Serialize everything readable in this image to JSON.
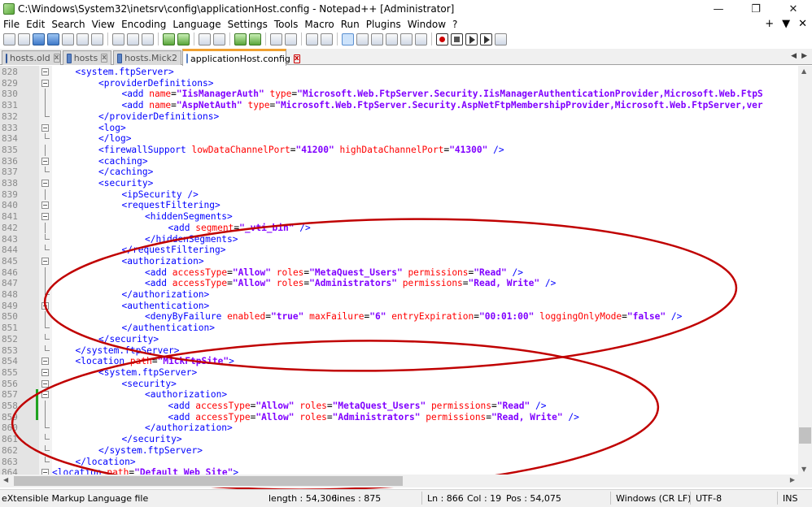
{
  "window": {
    "title": "C:\\Windows\\System32\\inetsrv\\config\\applicationHost.config - Notepad++ [Administrator]",
    "minimize": "—",
    "maximize": "❐",
    "close": "✕"
  },
  "menu": {
    "items": [
      "File",
      "Edit",
      "Search",
      "View",
      "Encoding",
      "Language",
      "Settings",
      "Tools",
      "Macro",
      "Run",
      "Plugins",
      "Window",
      "?"
    ],
    "right": [
      "+",
      "▼",
      "✕"
    ]
  },
  "tabs": [
    {
      "label": "hosts.old",
      "active": false
    },
    {
      "label": "hosts",
      "active": false
    },
    {
      "label": "hosts.Mick2",
      "active": false
    },
    {
      "label": "applicationHost.config",
      "active": true
    }
  ],
  "tab_scroll": [
    "◀",
    "▶"
  ],
  "editor": {
    "lines": [
      {
        "n": "828",
        "indent": 1,
        "parts": [
          [
            "br",
            "<"
          ],
          [
            "tag",
            "system.ftpServer"
          ],
          [
            "br",
            ">"
          ]
        ]
      },
      {
        "n": "829",
        "indent": 2,
        "parts": [
          [
            "br",
            "<"
          ],
          [
            "tag",
            "providerDefinitions"
          ],
          [
            "br",
            ">"
          ]
        ]
      },
      {
        "n": "830",
        "indent": 3,
        "parts": [
          [
            "br",
            "<"
          ],
          [
            "tag",
            "add"
          ],
          [
            "sp",
            " "
          ],
          [
            "attr",
            "name"
          ],
          [
            "eq",
            "="
          ],
          [
            "val",
            "\"IisManagerAuth\""
          ],
          [
            "sp",
            " "
          ],
          [
            "attr",
            "type"
          ],
          [
            "eq",
            "="
          ],
          [
            "val",
            "\"Microsoft.Web.FtpServer.Security.IisManagerAuthenticationProvider,Microsoft.Web.FtpS"
          ]
        ]
      },
      {
        "n": "831",
        "indent": 3,
        "parts": [
          [
            "br",
            "<"
          ],
          [
            "tag",
            "add"
          ],
          [
            "sp",
            " "
          ],
          [
            "attr",
            "name"
          ],
          [
            "eq",
            "="
          ],
          [
            "val",
            "\"AspNetAuth\""
          ],
          [
            "sp",
            " "
          ],
          [
            "attr",
            "type"
          ],
          [
            "eq",
            "="
          ],
          [
            "val",
            "\"Microsoft.Web.FtpServer.Security.AspNetFtpMembershipProvider,Microsoft.Web.FtpServer,ver"
          ]
        ]
      },
      {
        "n": "832",
        "indent": 2,
        "parts": [
          [
            "br",
            "</"
          ],
          [
            "tag",
            "providerDefinitions"
          ],
          [
            "br",
            ">"
          ]
        ]
      },
      {
        "n": "833",
        "indent": 2,
        "parts": [
          [
            "br",
            "<"
          ],
          [
            "tag",
            "log"
          ],
          [
            "br",
            ">"
          ]
        ]
      },
      {
        "n": "834",
        "indent": 2,
        "parts": [
          [
            "br",
            "</"
          ],
          [
            "tag",
            "log"
          ],
          [
            "br",
            ">"
          ]
        ]
      },
      {
        "n": "835",
        "indent": 2,
        "parts": [
          [
            "br",
            "<"
          ],
          [
            "tag",
            "firewallSupport"
          ],
          [
            "sp",
            " "
          ],
          [
            "attr",
            "lowDataChannelPort"
          ],
          [
            "eq",
            "="
          ],
          [
            "val",
            "\"41200\""
          ],
          [
            "sp",
            " "
          ],
          [
            "attr",
            "highDataChannelPort"
          ],
          [
            "eq",
            "="
          ],
          [
            "val",
            "\"41300\""
          ],
          [
            "sp",
            " "
          ],
          [
            "br",
            "/>"
          ]
        ]
      },
      {
        "n": "836",
        "indent": 2,
        "parts": [
          [
            "br",
            "<"
          ],
          [
            "tag",
            "caching"
          ],
          [
            "br",
            ">"
          ]
        ]
      },
      {
        "n": "837",
        "indent": 2,
        "parts": [
          [
            "br",
            "</"
          ],
          [
            "tag",
            "caching"
          ],
          [
            "br",
            ">"
          ]
        ]
      },
      {
        "n": "838",
        "indent": 2,
        "parts": [
          [
            "br",
            "<"
          ],
          [
            "tag",
            "security"
          ],
          [
            "br",
            ">"
          ]
        ]
      },
      {
        "n": "839",
        "indent": 3,
        "parts": [
          [
            "br",
            "<"
          ],
          [
            "tag",
            "ipSecurity"
          ],
          [
            "sp",
            " "
          ],
          [
            "br",
            "/>"
          ]
        ]
      },
      {
        "n": "840",
        "indent": 3,
        "parts": [
          [
            "br",
            "<"
          ],
          [
            "tag",
            "requestFiltering"
          ],
          [
            "br",
            ">"
          ]
        ]
      },
      {
        "n": "841",
        "indent": 4,
        "parts": [
          [
            "br",
            "<"
          ],
          [
            "tag",
            "hiddenSegments"
          ],
          [
            "br",
            ">"
          ]
        ]
      },
      {
        "n": "842",
        "indent": 5,
        "parts": [
          [
            "br",
            "<"
          ],
          [
            "tag",
            "add"
          ],
          [
            "sp",
            " "
          ],
          [
            "attr",
            "segment"
          ],
          [
            "eq",
            "="
          ],
          [
            "val",
            "\"_vti_bin\""
          ],
          [
            "sp",
            " "
          ],
          [
            "br",
            "/>"
          ]
        ]
      },
      {
        "n": "843",
        "indent": 4,
        "parts": [
          [
            "br",
            "</"
          ],
          [
            "tag",
            "hiddenSegments"
          ],
          [
            "br",
            ">"
          ]
        ]
      },
      {
        "n": "844",
        "indent": 3,
        "parts": [
          [
            "br",
            "</"
          ],
          [
            "tag",
            "requestFiltering"
          ],
          [
            "br",
            ">"
          ]
        ]
      },
      {
        "n": "845",
        "indent": 3,
        "parts": [
          [
            "br",
            "<"
          ],
          [
            "tag",
            "authorization"
          ],
          [
            "br",
            ">"
          ]
        ]
      },
      {
        "n": "846",
        "indent": 4,
        "parts": [
          [
            "br",
            "<"
          ],
          [
            "tag",
            "add"
          ],
          [
            "sp",
            " "
          ],
          [
            "attr",
            "accessType"
          ],
          [
            "eq",
            "="
          ],
          [
            "val",
            "\"Allow\""
          ],
          [
            "sp",
            " "
          ],
          [
            "attr",
            "roles"
          ],
          [
            "eq",
            "="
          ],
          [
            "val",
            "\"MetaQuest_Users\""
          ],
          [
            "sp",
            " "
          ],
          [
            "attr",
            "permissions"
          ],
          [
            "eq",
            "="
          ],
          [
            "val",
            "\"Read\""
          ],
          [
            "sp",
            " "
          ],
          [
            "br",
            "/>"
          ]
        ]
      },
      {
        "n": "847",
        "indent": 4,
        "parts": [
          [
            "br",
            "<"
          ],
          [
            "tag",
            "add"
          ],
          [
            "sp",
            " "
          ],
          [
            "attr",
            "accessType"
          ],
          [
            "eq",
            "="
          ],
          [
            "val",
            "\"Allow\""
          ],
          [
            "sp",
            " "
          ],
          [
            "attr",
            "roles"
          ],
          [
            "eq",
            "="
          ],
          [
            "val",
            "\"Administrators\""
          ],
          [
            "sp",
            " "
          ],
          [
            "attr",
            "permissions"
          ],
          [
            "eq",
            "="
          ],
          [
            "val",
            "\"Read, Write\""
          ],
          [
            "sp",
            " "
          ],
          [
            "br",
            "/>"
          ]
        ]
      },
      {
        "n": "848",
        "indent": 3,
        "parts": [
          [
            "br",
            "</"
          ],
          [
            "tag",
            "authorization"
          ],
          [
            "br",
            ">"
          ]
        ]
      },
      {
        "n": "849",
        "indent": 3,
        "parts": [
          [
            "br",
            "<"
          ],
          [
            "tag",
            "authentication"
          ],
          [
            "br",
            ">"
          ]
        ]
      },
      {
        "n": "850",
        "indent": 4,
        "parts": [
          [
            "br",
            "<"
          ],
          [
            "tag",
            "denyByFailure"
          ],
          [
            "sp",
            " "
          ],
          [
            "attr",
            "enabled"
          ],
          [
            "eq",
            "="
          ],
          [
            "val",
            "\"true\""
          ],
          [
            "sp",
            " "
          ],
          [
            "attr",
            "maxFailure"
          ],
          [
            "eq",
            "="
          ],
          [
            "val",
            "\"6\""
          ],
          [
            "sp",
            " "
          ],
          [
            "attr",
            "entryExpiration"
          ],
          [
            "eq",
            "="
          ],
          [
            "val",
            "\"00:01:00\""
          ],
          [
            "sp",
            " "
          ],
          [
            "attr",
            "loggingOnlyMode"
          ],
          [
            "eq",
            "="
          ],
          [
            "val",
            "\"false\""
          ],
          [
            "sp",
            " "
          ],
          [
            "br",
            "/>"
          ]
        ]
      },
      {
        "n": "851",
        "indent": 3,
        "parts": [
          [
            "br",
            "</"
          ],
          [
            "tag",
            "authentication"
          ],
          [
            "br",
            ">"
          ]
        ]
      },
      {
        "n": "852",
        "indent": 2,
        "parts": [
          [
            "br",
            "</"
          ],
          [
            "tag",
            "security"
          ],
          [
            "br",
            ">"
          ]
        ]
      },
      {
        "n": "853",
        "indent": 1,
        "parts": [
          [
            "br",
            "</"
          ],
          [
            "tag",
            "system.ftpServer"
          ],
          [
            "br",
            ">"
          ]
        ]
      },
      {
        "n": "854",
        "indent": 1,
        "parts": [
          [
            "br",
            "<"
          ],
          [
            "tag",
            "location"
          ],
          [
            "sp",
            " "
          ],
          [
            "attr",
            "path"
          ],
          [
            "eq",
            "="
          ],
          [
            "val",
            "\"MickFtpSite\""
          ],
          [
            "br",
            ">"
          ]
        ]
      },
      {
        "n": "855",
        "indent": 2,
        "parts": [
          [
            "br",
            "<"
          ],
          [
            "tag",
            "system.ftpServer"
          ],
          [
            "br",
            ">"
          ]
        ]
      },
      {
        "n": "856",
        "indent": 3,
        "parts": [
          [
            "br",
            "<"
          ],
          [
            "tag",
            "security"
          ],
          [
            "br",
            ">"
          ]
        ]
      },
      {
        "n": "857",
        "indent": 4,
        "parts": [
          [
            "br",
            "<"
          ],
          [
            "tag",
            "authorization"
          ],
          [
            "br",
            ">"
          ]
        ]
      },
      {
        "n": "858",
        "indent": 5,
        "parts": [
          [
            "br",
            "<"
          ],
          [
            "tag",
            "add"
          ],
          [
            "sp",
            " "
          ],
          [
            "attr",
            "accessType"
          ],
          [
            "eq",
            "="
          ],
          [
            "val",
            "\"Allow\""
          ],
          [
            "sp",
            " "
          ],
          [
            "attr",
            "roles"
          ],
          [
            "eq",
            "="
          ],
          [
            "val",
            "\"MetaQuest_Users\""
          ],
          [
            "sp",
            " "
          ],
          [
            "attr",
            "permissions"
          ],
          [
            "eq",
            "="
          ],
          [
            "val",
            "\"Read\""
          ],
          [
            "sp",
            " "
          ],
          [
            "br",
            "/>"
          ]
        ]
      },
      {
        "n": "859",
        "indent": 5,
        "parts": [
          [
            "br",
            "<"
          ],
          [
            "tag",
            "add"
          ],
          [
            "sp",
            " "
          ],
          [
            "attr",
            "accessType"
          ],
          [
            "eq",
            "="
          ],
          [
            "val",
            "\"Allow\""
          ],
          [
            "sp",
            " "
          ],
          [
            "attr",
            "roles"
          ],
          [
            "eq",
            "="
          ],
          [
            "val",
            "\"Administrators\""
          ],
          [
            "sp",
            " "
          ],
          [
            "attr",
            "permissions"
          ],
          [
            "eq",
            "="
          ],
          [
            "val",
            "\"Read, Write\""
          ],
          [
            "sp",
            " "
          ],
          [
            "br",
            "/>"
          ]
        ]
      },
      {
        "n": "860",
        "indent": 4,
        "parts": [
          [
            "br",
            "</"
          ],
          [
            "tag",
            "authorization"
          ],
          [
            "br",
            ">"
          ]
        ]
      },
      {
        "n": "861",
        "indent": 3,
        "parts": [
          [
            "br",
            "</"
          ],
          [
            "tag",
            "security"
          ],
          [
            "br",
            ">"
          ]
        ]
      },
      {
        "n": "862",
        "indent": 2,
        "parts": [
          [
            "br",
            "</"
          ],
          [
            "tag",
            "system.ftpServer"
          ],
          [
            "br",
            ">"
          ]
        ]
      },
      {
        "n": "863",
        "indent": 1,
        "parts": [
          [
            "br",
            "</"
          ],
          [
            "tag",
            "location"
          ],
          [
            "br",
            ">"
          ]
        ]
      },
      {
        "n": "864",
        "indent": 0,
        "parts": [
          [
            "br",
            "<"
          ],
          [
            "tag",
            "location"
          ],
          [
            "sp",
            " "
          ],
          [
            "attr",
            "path"
          ],
          [
            "eq",
            "="
          ],
          [
            "val",
            "\"Default Web Site\""
          ],
          [
            "br",
            ">"
          ]
        ]
      }
    ]
  },
  "statusbar": {
    "file_type": "eXtensible Markup Language file",
    "length": "length : 54,306",
    "lines": "lines : 875",
    "position": "Ln : 866",
    "column": "Col : 19",
    "pos": "Pos : 54,075",
    "eol": "Windows (CR LF)",
    "encoding": "UTF-8",
    "mode": "INS"
  },
  "colors": {
    "tag": "#0000ff",
    "attribute": "#ff0000",
    "value": "#8000ff",
    "annotation": "#c00000"
  }
}
